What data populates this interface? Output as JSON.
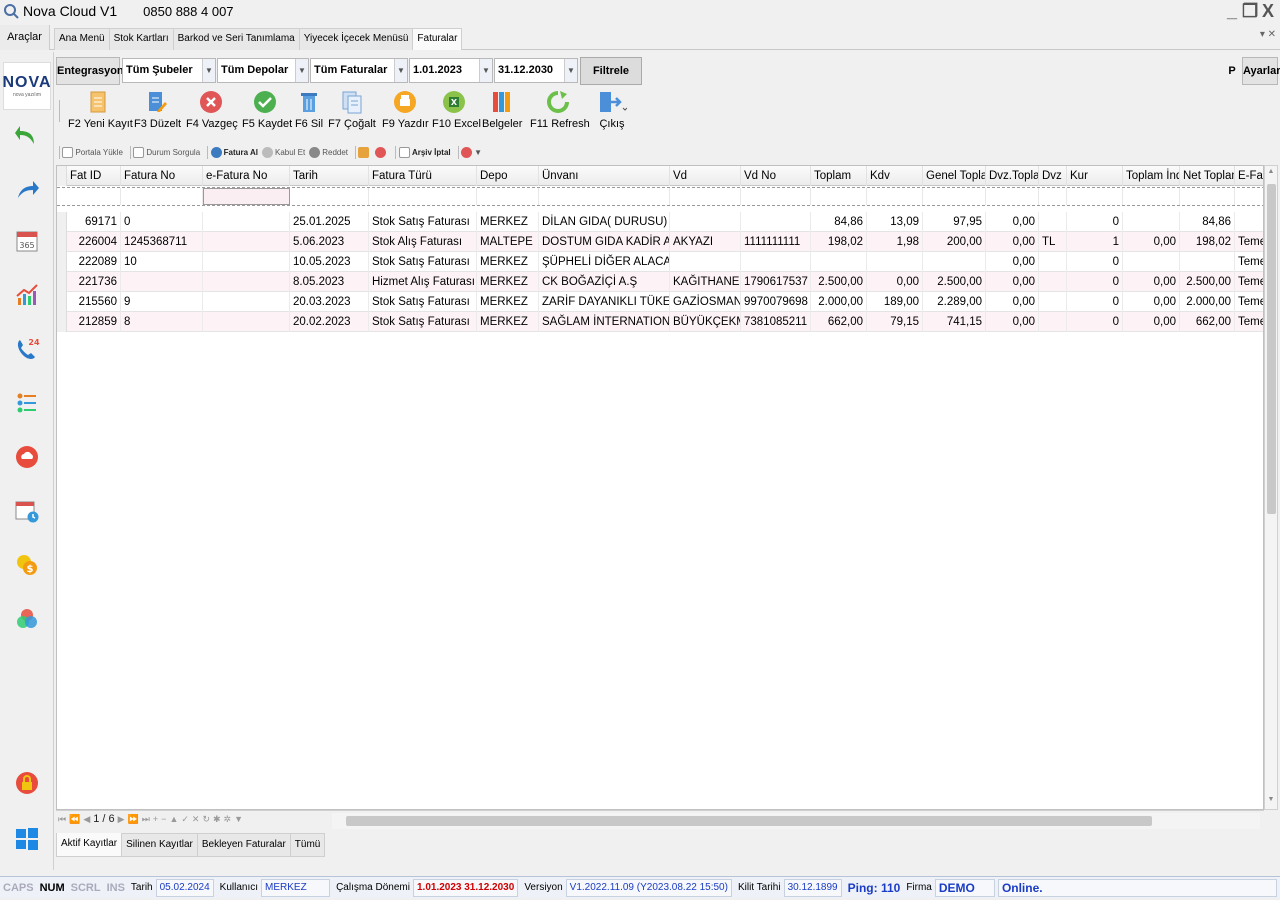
{
  "window": {
    "title": "Nova Cloud V1",
    "phone": "0850 888 4 007",
    "controls": [
      "_",
      "❒",
      "X"
    ]
  },
  "menu": {
    "araclar": "Araçlar",
    "tabs": [
      {
        "label": "Ana Menü"
      },
      {
        "label": "Stok Kartları"
      },
      {
        "label": "Barkod ve Seri Tanımlama"
      },
      {
        "label": "Yiyecek İçecek Menüsü"
      },
      {
        "label": "Faturalar"
      }
    ],
    "tab_controls": "▾ ✕"
  },
  "sidebar": {
    "logo_text": "NOVA",
    "logo_sub": "nova yazılım"
  },
  "filters": {
    "entegrasyon": "Entegrasyon",
    "subeler": "Tüm Şubeler",
    "depolar": "Tüm Depolar",
    "faturalar": "Tüm Faturalar",
    "start_date": "1.01.2023",
    "end_date": "31.12.2030",
    "filtrele": "Filtrele",
    "p": "P",
    "ayarlar": "Ayarlar"
  },
  "toolbar": {
    "new": "F2 Yeni Kayıt",
    "edit": "F3 Düzelt",
    "cancel": "F4 Vazgeç",
    "save": "F5 Kaydet",
    "delete": "F6 Sil",
    "copy": "F7 Çoğalt",
    "print": "F9 Yazdır",
    "excel": "F10 Excel",
    "docs": "Belgeler",
    "refresh": "F11 Refresh",
    "exit": "Çıkış"
  },
  "subtoolbar": {
    "portal": "Portala Yükle",
    "status": "Durum Sorgula",
    "fatura_al": "Fatura Al",
    "kabul": "Kabul Et",
    "reddet": "Reddet",
    "arsiv": "Arşiv İptal"
  },
  "grid": {
    "columns": [
      "Fat ID",
      "Fatura No",
      "e-Fatura No",
      "Tarih",
      "Fatura Türü",
      "Depo",
      "Ünvanı",
      "Vd",
      "Vd No",
      "Toplam",
      "Kdv",
      "Genel Toplam",
      "Dvz.Toplam",
      "Dvz",
      "Kur",
      "Toplam İnd.",
      "Net Toplam",
      "E-Fatura"
    ],
    "rows": [
      [
        "69171",
        "0",
        "",
        "25.01.2025",
        "Stok Satış Faturası",
        "MERKEZ",
        "DİLAN GIDA( DURUSU)",
        "",
        "",
        "84,86",
        "13,09",
        "97,95",
        "0,00",
        "",
        "0",
        "",
        "84,86",
        ""
      ],
      [
        "226004",
        "1245368711",
        "",
        "5.06.2023",
        "Stok Alış Faturası",
        "MALTEPE",
        "DOSTUM GIDA KADİR ADAPAZARI",
        "AKYAZI",
        "1111111111",
        "198,02",
        "1,98",
        "200,00",
        "0,00",
        "TL",
        "1",
        "0,00",
        "198,02",
        "Temel"
      ],
      [
        "222089",
        "10",
        "",
        "10.05.2023",
        "Stok Satış Faturası",
        "MERKEZ",
        "ŞÜPHELİ DİĞER ALACAKLAR",
        "",
        "",
        "",
        "",
        "",
        "0,00",
        "",
        "0",
        "",
        "",
        "Temel"
      ],
      [
        "221736",
        "",
        "",
        "8.05.2023",
        "Hizmet Alış Faturası",
        "MERKEZ",
        "CK BOĞAZİÇİ A.Ş",
        "KAĞITHANE",
        "1790617537",
        "2.500,00",
        "0,00",
        "2.500,00",
        "0,00",
        "",
        "0",
        "0,00",
        "2.500,00",
        "Temel"
      ],
      [
        "215560",
        "9",
        "",
        "20.03.2023",
        "Stok Satış Faturası",
        "MERKEZ",
        "ZARİF DAYANIKLI TÜKETİM",
        "GAZİOSMANPAŞA",
        "9970079698",
        "2.000,00",
        "189,00",
        "2.289,00",
        "0,00",
        "",
        "0",
        "0,00",
        "2.000,00",
        "Temel"
      ],
      [
        "212859",
        "8",
        "",
        "20.02.2023",
        "Stok Satış Faturası",
        "MERKEZ",
        "SAĞLAM İNTERNATIONAL LOJİSTİK",
        "BÜYÜKÇEKMECE",
        "7381085211",
        "662,00",
        "79,15",
        "741,15",
        "0,00",
        "",
        "0",
        "0,00",
        "662,00",
        "Temel"
      ]
    ]
  },
  "navigator": {
    "page": "1 / 6"
  },
  "bottom_tabs": [
    {
      "label": "Aktif Kayıtlar"
    },
    {
      "label": "Silinen Kayıtlar"
    },
    {
      "label": "Bekleyen Faturalar"
    },
    {
      "label": "Tümü"
    }
  ],
  "status": {
    "caps": "CAPS",
    "num": "NUM",
    "scrl": "SCRL",
    "ins": "INS",
    "tarih_label": "Tarih",
    "tarih": "05.02.2024",
    "kullanici_label": "Kullanıcı",
    "kullanici": "MERKEZ",
    "donem_label": "Çalışma Dönemi",
    "donem": "1.01.2023  31.12.2030",
    "versiyon_label": "Versiyon",
    "versiyon": "V1.2022.11.09 (Y2023.08.22 15:50)",
    "kilit_label": "Kilit Tarihi",
    "kilit": "30.12.1899",
    "ping": "Ping: 110",
    "firma_label": "Firma",
    "firma": "DEMO",
    "online": "Online."
  },
  "colors": {
    "accent_blue": "#1b3cc4",
    "status_red": "#d00000",
    "row_alt": "#fdf3f6"
  }
}
